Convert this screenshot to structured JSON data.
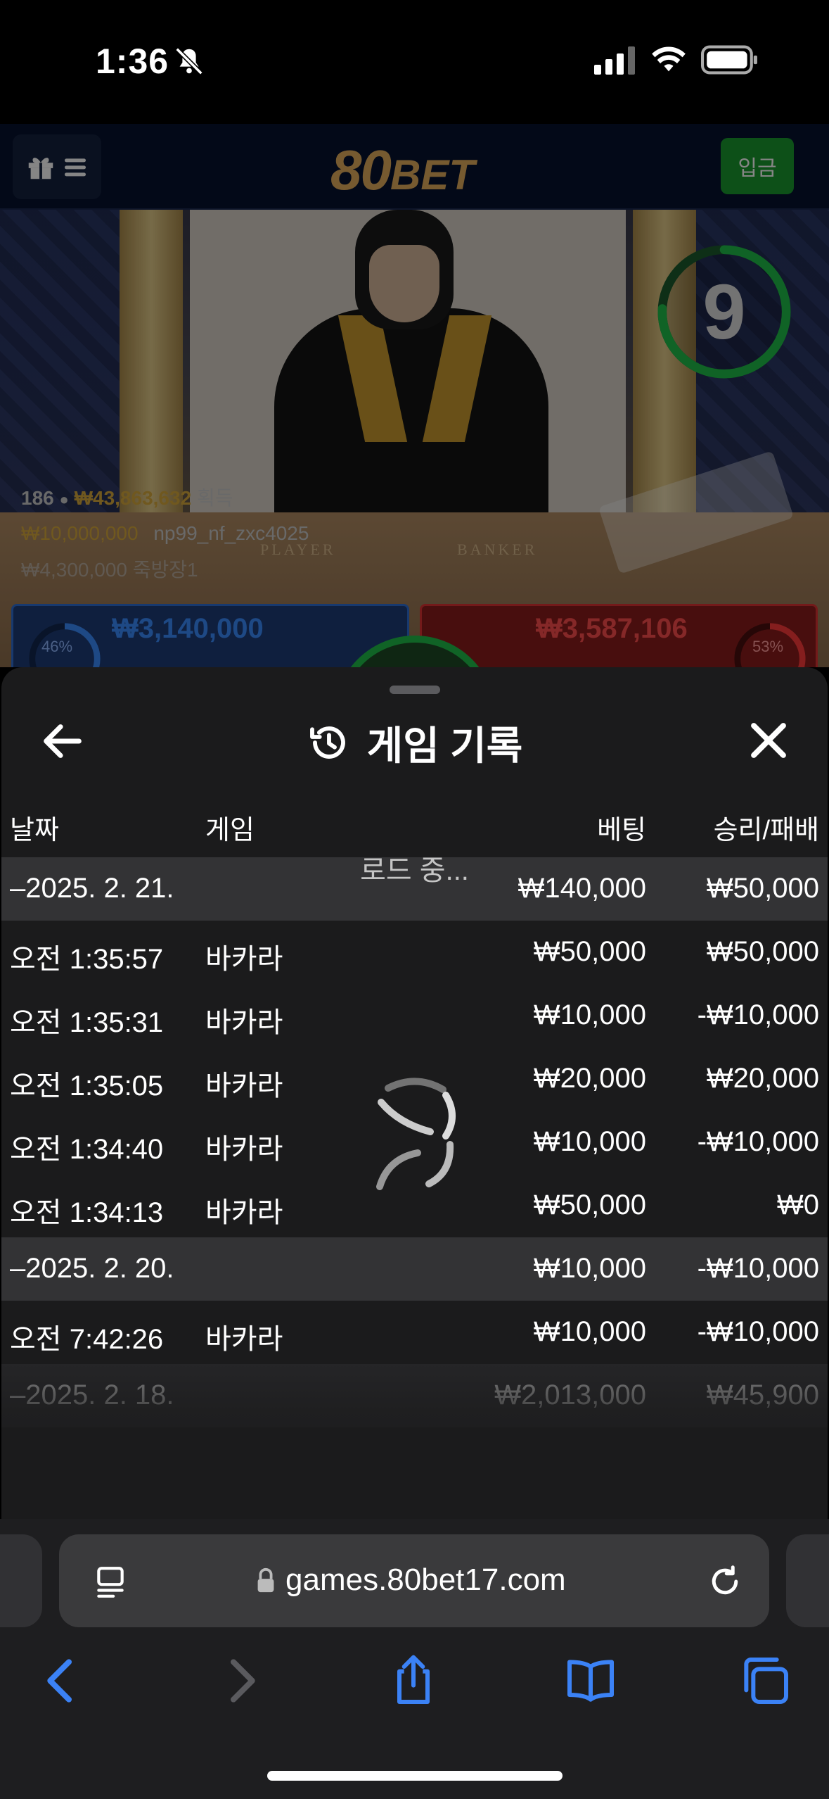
{
  "status_bar": {
    "time": "1:36",
    "icons": [
      "bell-slash-icon",
      "cellular-signal-icon",
      "wifi-icon",
      "battery-icon"
    ]
  },
  "app_header": {
    "logo_main": "80",
    "logo_suffix": "BET",
    "deposit_label": "입금",
    "menu_icon": "gift-menu-icon"
  },
  "game_view": {
    "timer": "9",
    "overlay_count": "186",
    "overlay_win_amount": "₩43,863,632",
    "overlay_win_label": "획득",
    "overlay_bet_amount": "₩10,000,000",
    "overlay_bet_user": "np99_nf_zxc4025",
    "overlay_third_line": "₩4,300,000  죽방장1",
    "table_player": "PLAYER",
    "table_banker": "BANKER",
    "player_total": "₩3,140,000",
    "player_pct": "46%",
    "banker_total": "₩3,587,106",
    "banker_pct": "53%"
  },
  "sheet": {
    "title": "게임 기록",
    "columns": {
      "date": "날짜",
      "game": "게임",
      "bet": "베팅",
      "winloss": "승리/패배"
    },
    "rows": [
      {
        "type": "date",
        "date": "–2025. 2. 21.",
        "game": "",
        "bet": "₩140,000",
        "winloss": "₩50,000"
      },
      {
        "type": "item",
        "date": "오전 1:35:57",
        "game": "바카라",
        "bet": "₩50,000",
        "winloss": "₩50,000"
      },
      {
        "type": "item",
        "date": "오전 1:35:31",
        "game": "바카라",
        "bet": "₩10,000",
        "winloss": "-₩10,000"
      },
      {
        "type": "item",
        "date": "오전 1:35:05",
        "game": "바카라",
        "bet": "₩20,000",
        "winloss": "₩20,000"
      },
      {
        "type": "item",
        "date": "오전 1:34:40",
        "game": "바카라",
        "bet": "₩10,000",
        "winloss": "-₩10,000"
      },
      {
        "type": "item",
        "date": "오전 1:34:13",
        "game": "바카라",
        "bet": "₩50,000",
        "winloss": "₩0"
      },
      {
        "type": "date",
        "date": "–2025. 2. 20.",
        "game": "",
        "bet": "₩10,000",
        "winloss": "-₩10,000"
      },
      {
        "type": "item",
        "date": "오전 7:42:26",
        "game": "바카라",
        "bet": "₩10,000",
        "winloss": "-₩10,000"
      },
      {
        "type": "date",
        "date": "–2025. 2. 18.",
        "game": "",
        "bet": "₩2,013,000",
        "winloss": "₩45,900"
      }
    ],
    "loading_text": "로드 중..."
  },
  "browser": {
    "url": "games.80bet17.com",
    "toolbar": [
      "back-icon",
      "forward-icon",
      "share-icon",
      "bookmarks-icon",
      "tabs-icon"
    ]
  },
  "colors": {
    "header_bg": "#06122e",
    "logo": "#e2ad5c",
    "deposit": "#1a9a2e",
    "sheet_bg": "#1b1b1c",
    "date_row_bg": "#333335",
    "link_blue": "#3b82f6"
  }
}
